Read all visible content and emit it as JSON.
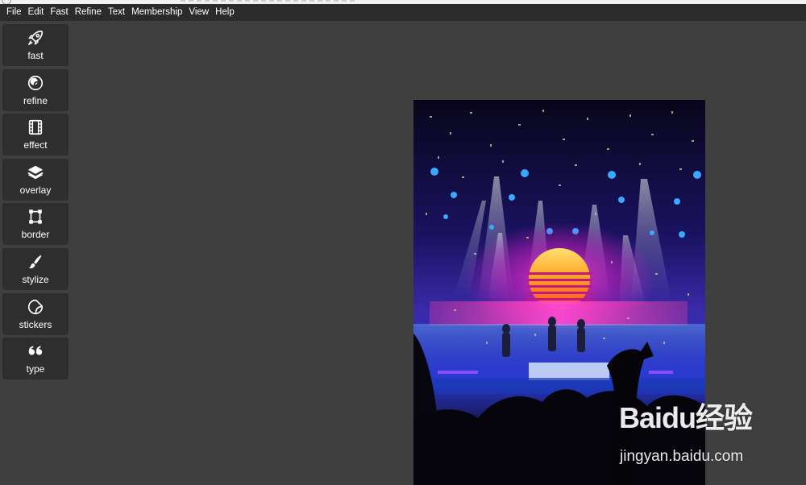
{
  "menu": {
    "items": [
      "File",
      "Edit",
      "Fast",
      "Refine",
      "Text",
      "Membership",
      "View",
      "Help"
    ]
  },
  "tools": [
    {
      "label": "fast",
      "icon": "rocket-icon"
    },
    {
      "label": "refine",
      "icon": "refine-circles-icon"
    },
    {
      "label": "effect",
      "icon": "film-icon"
    },
    {
      "label": "overlay",
      "icon": "layers-icon"
    },
    {
      "label": "border",
      "icon": "border-frame-icon"
    },
    {
      "label": "stylize",
      "icon": "brush-icon"
    },
    {
      "label": "stickers",
      "icon": "sticker-icon"
    },
    {
      "label": "type",
      "icon": "quote-icon"
    }
  ],
  "watermark": {
    "brand": "Baidu经验",
    "url": "jingyan.baidu.com"
  },
  "colors": {
    "background": "#3f3f3f",
    "menubar": "#2b2b2b",
    "tool_button": "#2e2e2e"
  }
}
